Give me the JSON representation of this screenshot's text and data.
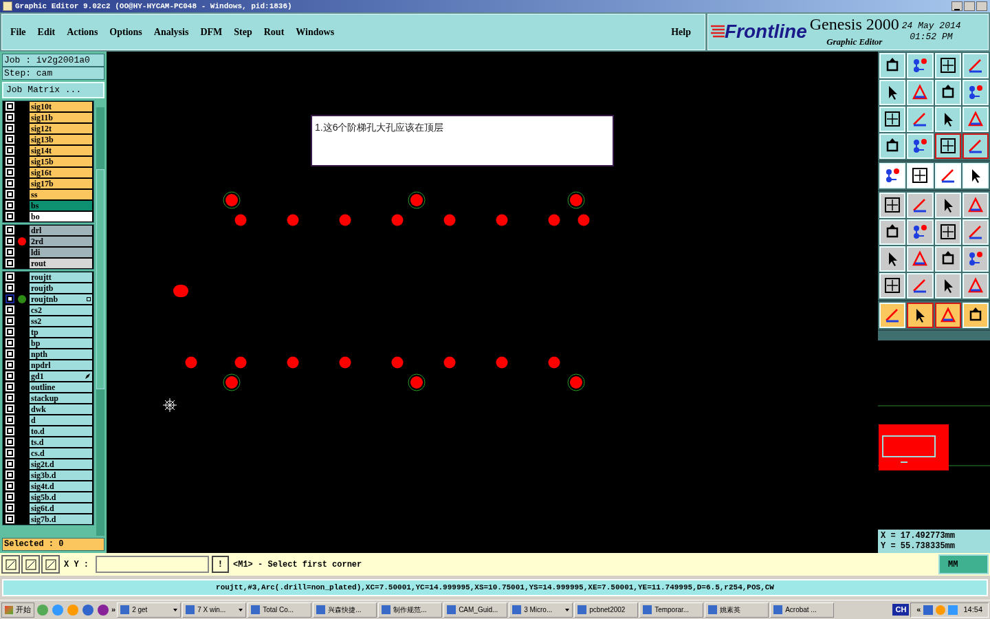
{
  "window": {
    "title": "Graphic Editor 9.02c2 (OO@HY-HYCAM-PC048 - Windows, pid:1836)"
  },
  "menu": [
    {
      "label": "File"
    },
    {
      "label": "Edit"
    },
    {
      "label": "Actions"
    },
    {
      "label": "Options"
    },
    {
      "label": "Analysis"
    },
    {
      "label": "DFM"
    },
    {
      "label": "Step"
    },
    {
      "label": "Rout"
    },
    {
      "label": "Windows"
    }
  ],
  "help": "Help",
  "brand": {
    "logo": "Frontline",
    "product": "Genesis 2000",
    "subtitle": "Graphic Editor",
    "date": "24 May 2014",
    "time": "01:52 PM"
  },
  "job": {
    "job": "Job  :  iv2g2001a0",
    "step": "Step:  cam",
    "matrix_button": "Job Matrix ..."
  },
  "layer_groups": [
    {
      "layers": [
        {
          "name": "sig10t",
          "color": "#fcc65e",
          "selected": false
        },
        {
          "name": "sig11b",
          "color": "#fcc65e",
          "selected": false
        },
        {
          "name": "sig12t",
          "color": "#fcc65e",
          "selected": false
        },
        {
          "name": "sig13b",
          "color": "#fcc65e",
          "selected": false
        },
        {
          "name": "sig14t",
          "color": "#fcc65e",
          "selected": false
        },
        {
          "name": "sig15b",
          "color": "#fcc65e",
          "selected": false
        },
        {
          "name": "sig16t",
          "color": "#fcc65e",
          "selected": false
        },
        {
          "name": "sig17b",
          "color": "#fcc65e",
          "selected": false
        },
        {
          "name": "ss",
          "color": "#fcc65e",
          "selected": false
        },
        {
          "name": "bs",
          "color": "#0e9170",
          "selected": false
        },
        {
          "name": "bo",
          "color": "#ffffff",
          "selected": false
        }
      ]
    },
    {
      "layers": [
        {
          "name": "drl",
          "color": "#9fb3b8",
          "selected": false
        },
        {
          "name": "2rd",
          "color": "#9fb3b8",
          "selected": false,
          "dot": {
            "color": "#ff0000"
          }
        },
        {
          "name": "ldi",
          "color": "#9fb3b8",
          "selected": false
        },
        {
          "name": "rout",
          "color": "#d6d6d6",
          "selected": false
        }
      ]
    },
    {
      "layers": [
        {
          "name": "roujtt",
          "color": "#9fdcdc",
          "selected": false
        },
        {
          "name": "roujtb",
          "color": "#9fdcdc",
          "selected": false
        },
        {
          "name": "roujtnb",
          "color": "#9fdcdc",
          "selected": true,
          "dot": {
            "color": "#2e8b16"
          },
          "kind": "plus"
        },
        {
          "name": "cs2",
          "color": "#9fdcdc",
          "selected": false
        },
        {
          "name": "ss2",
          "color": "#9fdcdc",
          "selected": false
        },
        {
          "name": "tp",
          "color": "#9fdcdc",
          "selected": false
        },
        {
          "name": "bp",
          "color": "#9fdcdc",
          "selected": false
        },
        {
          "name": "npth",
          "color": "#9fdcdc",
          "selected": false
        },
        {
          "name": "npdrl",
          "color": "#9fdcdc",
          "selected": false
        },
        {
          "name": "gd1",
          "color": "#9fdcdc",
          "selected": false,
          "kind": "pointer"
        },
        {
          "name": "outline",
          "color": "#9fdcdc",
          "selected": false
        },
        {
          "name": "stackup",
          "color": "#9fdcdc",
          "selected": false
        },
        {
          "name": "dwk",
          "color": "#9fdcdc",
          "selected": false
        },
        {
          "name": "d",
          "color": "#9fdcdc",
          "selected": false
        },
        {
          "name": "to.d",
          "color": "#9fdcdc",
          "selected": false
        },
        {
          "name": "ts.d",
          "color": "#9fdcdc",
          "selected": false
        },
        {
          "name": "cs.d",
          "color": "#9fdcdc",
          "selected": false
        },
        {
          "name": "sig2t.d",
          "color": "#9fdcdc",
          "selected": false
        },
        {
          "name": "sig3b.d",
          "color": "#9fdcdc",
          "selected": false
        },
        {
          "name": "sig4t.d",
          "color": "#9fdcdc",
          "selected": false
        },
        {
          "name": "sig5b.d",
          "color": "#9fdcdc",
          "selected": false
        },
        {
          "name": "sig6t.d",
          "color": "#9fdcdc",
          "selected": false
        },
        {
          "name": "sig7b.d",
          "color": "#9fdcdc",
          "selected": false
        }
      ]
    }
  ],
  "selected_count": "Selected : 0",
  "note": "1.这6个阶梯孔大孔应该在顶层",
  "toolbar": [
    {
      "color": "#9fdcdc",
      "buttons": [
        {
          "selected": false
        },
        {
          "selected": false
        },
        {
          "selected": false
        },
        {
          "selected": false
        },
        {
          "selected": false
        },
        {
          "selected": false
        },
        {
          "selected": false
        },
        {
          "selected": false
        },
        {
          "selected": false
        },
        {
          "selected": false
        },
        {
          "selected": false
        },
        {
          "selected": false
        },
        {
          "selected": false
        },
        {
          "selected": false
        },
        {
          "selected": true
        },
        {
          "selected": true
        }
      ]
    },
    {
      "color": "#ffffff",
      "buttons": [
        {
          "selected": false
        },
        {
          "selected": false
        },
        {
          "selected": false
        },
        {
          "selected": false
        }
      ]
    },
    {
      "color": "#c9c9c9",
      "buttons": [
        {
          "selected": false
        },
        {
          "selected": false
        },
        {
          "selected": false
        },
        {
          "selected": false
        },
        {
          "selected": false
        },
        {
          "selected": false
        },
        {
          "selected": false
        },
        {
          "selected": false
        },
        {
          "selected": false
        },
        {
          "selected": false
        },
        {
          "selected": false
        },
        {
          "selected": false
        },
        {
          "selected": false
        },
        {
          "selected": false
        },
        {
          "selected": false
        },
        {
          "selected": false
        }
      ]
    },
    {
      "color": "#fcc65e",
      "buttons": [
        {
          "selected": false
        },
        {
          "selected": true
        },
        {
          "selected": true
        },
        {
          "selected": false
        }
      ]
    }
  ],
  "coords": {
    "x": "X  =  17.492773mm",
    "y": "Y  =  55.738335mm"
  },
  "command": {
    "xy_label": "X Y :",
    "alert": "!",
    "message": "<M1> - Select first corner",
    "units": "MM"
  },
  "info": "roujtt,#3,Arc(.drill=non_plated),XC=7.50001,YC=14.999995,XS=10.75001,YS=14.999995,XE=7.50001,YE=11.749995,D=6.5,r254,POS,CW",
  "taskbar": {
    "start": "开始",
    "more": "»",
    "tasks": [
      {
        "label": "2 get",
        "group": true
      },
      {
        "label": "7 X win...",
        "group": true
      },
      {
        "label": "Total Co...",
        "group": false
      },
      {
        "label": "兴森快捷...",
        "group": false
      },
      {
        "label": "制作规范...",
        "group": false
      },
      {
        "label": "CAM_Guid...",
        "group": false
      },
      {
        "label": "3 Micro...",
        "group": true
      },
      {
        "label": "pcbnet2002",
        "group": false
      },
      {
        "label": "Temporar...",
        "group": false
      },
      {
        "label": "姚素英",
        "group": false
      },
      {
        "label": "Acrobat ...",
        "group": false
      }
    ],
    "lang": "CH",
    "tray_more": "«",
    "clock": "14:54"
  }
}
